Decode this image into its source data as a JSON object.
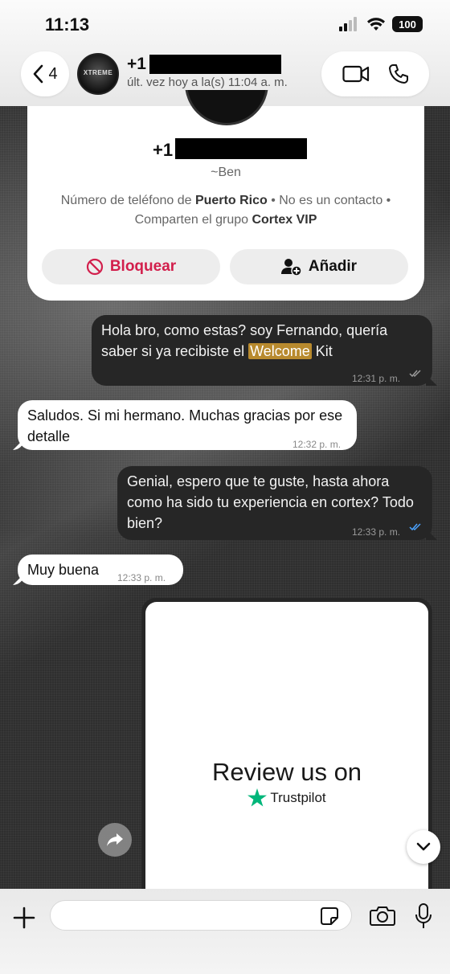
{
  "status_bar": {
    "time": "11:13",
    "battery": "100"
  },
  "header": {
    "back_count": "4",
    "avatar_text": "XTREME",
    "contact_name": "+1",
    "contact_status": "últ. vez hoy a la(s) 11:04 a. m."
  },
  "contact_card": {
    "number_prefix": "+1",
    "nickname": "~Ben",
    "info_line1_prefix": "Número de teléfono de ",
    "info_line1_country": "Puerto Rico",
    "info_line1_suffix": " • No es un contacto •",
    "info_line2_prefix": "Comparten el grupo ",
    "info_line2_group": "Cortex VIP",
    "block_label": "Bloquear",
    "add_label": "Añadir"
  },
  "messages": [
    {
      "direction": "out",
      "text_before": "Hola bro, como estas? soy Fernando, quería saber si ya recibiste el ",
      "highlight": "Welcome",
      "text_after": " Kit",
      "time": "12:31 p. m.",
      "status": "delivered"
    },
    {
      "direction": "in",
      "text": "Saludos. Si mi hermano. Muchas gracias por ese detalle",
      "time": "12:32 p. m."
    },
    {
      "direction": "out",
      "text": "Genial, espero que te guste, hasta ahora como ha sido tu experiencia en cortex? Todo bien?",
      "time": "12:33 p. m.",
      "status": "read"
    },
    {
      "direction": "in",
      "text": "Muy buena",
      "time": "12:33 p. m."
    }
  ],
  "image_message": {
    "review_text": "Review us on",
    "brand": "Trustpilot"
  },
  "composer": {
    "value": "",
    "placeholder": ""
  },
  "colors": {
    "block_red": "#d21f4c",
    "read_blue": "#4aa3ff",
    "outgoing_bubble": "#262626",
    "trustpilot_green": "#00b67a",
    "highlight": "#b88a2e"
  },
  "icons": [
    "chevron-left-icon",
    "video-call-icon",
    "phone-icon",
    "block-icon",
    "add-contact-icon",
    "forward-icon",
    "chevron-down-icon",
    "plus-icon",
    "sticker-icon",
    "camera-icon",
    "microphone-icon",
    "signal-icon",
    "wifi-icon"
  ]
}
